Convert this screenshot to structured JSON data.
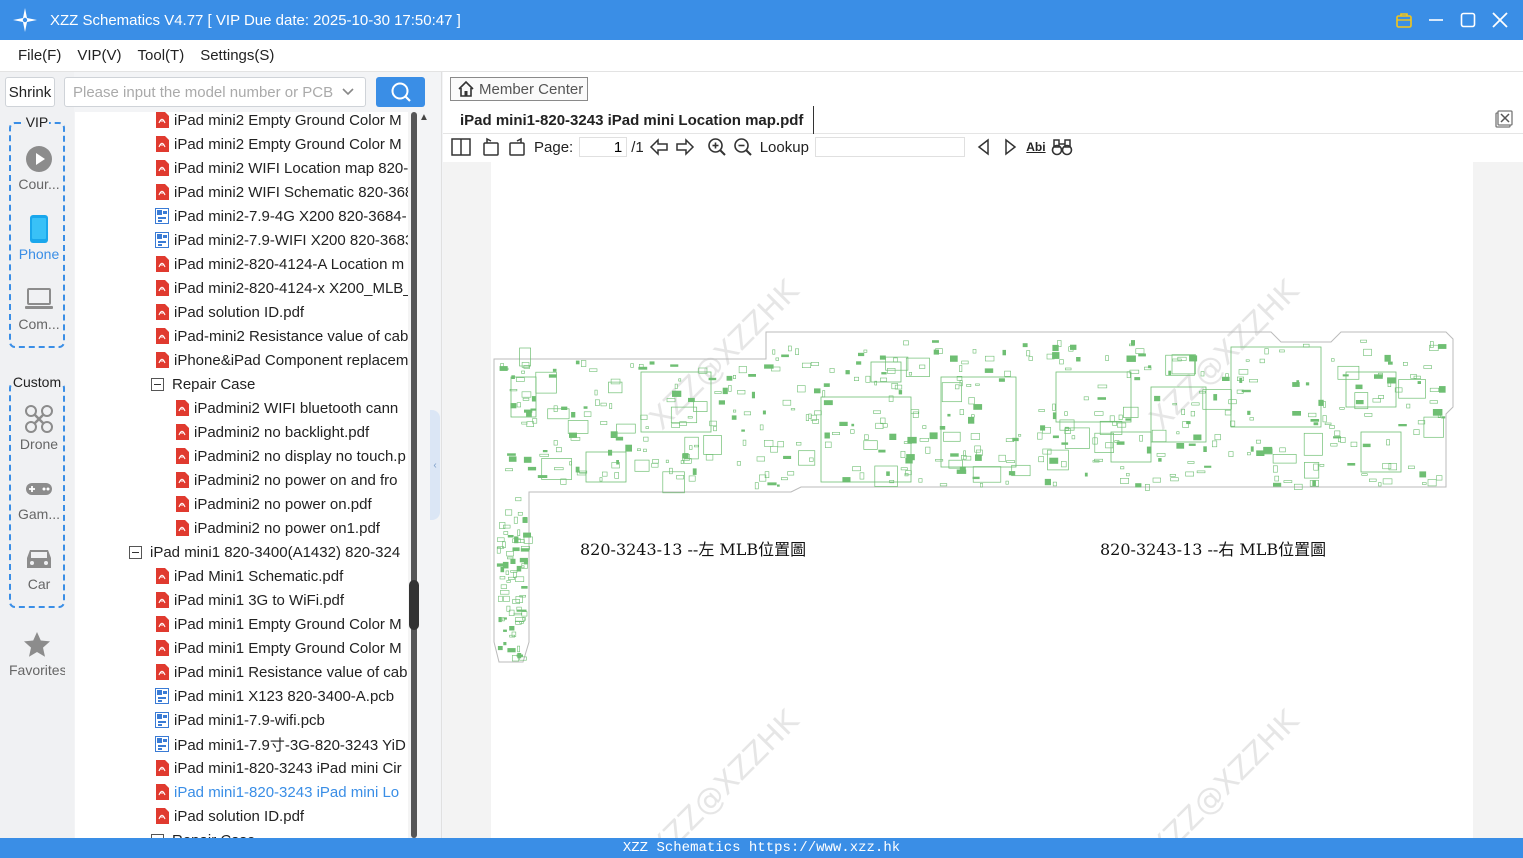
{
  "window": {
    "title": "XZZ Schematics V4.77 [ VIP Due date: 2025-10-30 17:50:47 ]",
    "controls": [
      "vip-bag-icon",
      "minimize-icon",
      "maximize-icon",
      "close-icon"
    ]
  },
  "menu": [
    {
      "label": "File(F)"
    },
    {
      "label": "VIP(V)"
    },
    {
      "label": "Tool(T)"
    },
    {
      "label": "Settings(S)"
    }
  ],
  "search": {
    "shrink_label": "Shrink",
    "placeholder": "Please input the model number or PCB",
    "value": ""
  },
  "rail": {
    "vip_group_title": "VIP",
    "custom_group_title": "Custom",
    "vip_items": [
      {
        "label": "Cour...",
        "icon": "play-circle-icon"
      },
      {
        "label": "Phone",
        "icon": "phone-icon",
        "active": true
      },
      {
        "label": "Com...",
        "icon": "laptop-icon"
      }
    ],
    "custom_items": [
      {
        "label": "Drone",
        "icon": "drone-icon"
      },
      {
        "label": "Gam...",
        "icon": "gamepad-icon"
      },
      {
        "label": "Car",
        "icon": "car-icon"
      }
    ],
    "favorites_label": "Favorites"
  },
  "tree": {
    "rows": [
      {
        "label": "iPad mini2 Empty Ground Color M",
        "type": "pdf",
        "indent": 1
      },
      {
        "label": "iPad mini2 Empty Ground Color M",
        "type": "pdf",
        "indent": 1
      },
      {
        "label": "iPad mini2 WIFI Location map 820-",
        "type": "pdf",
        "indent": 1
      },
      {
        "label": "iPad mini2 WIFI Schematic 820-368",
        "type": "pdf",
        "indent": 1
      },
      {
        "label": "iPad mini2-7.9-4G X200 820-3684-",
        "type": "pcb",
        "indent": 1
      },
      {
        "label": "iPad mini2-7.9-WIFI X200 820-3683",
        "type": "pcb",
        "indent": 1
      },
      {
        "label": "iPad mini2-820-4124-A Location m",
        "type": "pdf",
        "indent": 1
      },
      {
        "label": "iPad mini2-820-4124-x X200_MLB_",
        "type": "pdf",
        "indent": 1
      },
      {
        "label": "iPad solution ID.pdf",
        "type": "pdf",
        "indent": 1
      },
      {
        "label": "iPad-mini2 Resistance value of cab",
        "type": "pdf",
        "indent": 1
      },
      {
        "label": "iPhone&iPad Component replacem",
        "type": "pdf",
        "indent": 1
      },
      {
        "label": "Repair Case",
        "type": "folder",
        "indent": 1
      },
      {
        "label": "iPadmini2 WIFI bluetooth cann",
        "type": "pdf",
        "indent": 2
      },
      {
        "label": "iPadmini2 no backlight.pdf",
        "type": "pdf",
        "indent": 2
      },
      {
        "label": "iPadmini2 no display no touch.p",
        "type": "pdf",
        "indent": 2
      },
      {
        "label": "iPadmini2 no power on and fro",
        "type": "pdf",
        "indent": 2
      },
      {
        "label": "iPadmini2 no power on.pdf",
        "type": "pdf",
        "indent": 2
      },
      {
        "label": "iPadmini2 no power on1.pdf",
        "type": "pdf",
        "indent": 2
      },
      {
        "label": "iPad mini1 820-3400(A1432) 820-324",
        "type": "folder",
        "indent": 0
      },
      {
        "label": "iPad Mini1 Schematic.pdf",
        "type": "pdf",
        "indent": 1
      },
      {
        "label": "iPad mini1 3G to WiFi.pdf",
        "type": "pdf",
        "indent": 1
      },
      {
        "label": "iPad mini1 Empty Ground Color M",
        "type": "pdf",
        "indent": 1
      },
      {
        "label": "iPad mini1 Empty Ground Color M",
        "type": "pdf",
        "indent": 1
      },
      {
        "label": "iPad mini1 Resistance value of cab",
        "type": "pdf",
        "indent": 1
      },
      {
        "label": "iPad mini1 X123 820-3400-A.pcb",
        "type": "pcb",
        "indent": 1
      },
      {
        "label": "iPad mini1-7.9-wifi.pcb",
        "type": "pcb",
        "indent": 1
      },
      {
        "label": "iPad mini1-7.9寸-3G-820-3243 YiD",
        "type": "pcb",
        "indent": 1
      },
      {
        "label": "iPad mini1-820-3243 iPad mini Cir",
        "type": "pdf",
        "indent": 1
      },
      {
        "label": "iPad mini1-820-3243 iPad mini Lo",
        "type": "pdf",
        "indent": 1,
        "selected": true
      },
      {
        "label": "iPad solution ID.pdf",
        "type": "pdf",
        "indent": 1
      },
      {
        "label": "Repair Case",
        "type": "folder",
        "indent": 1
      }
    ]
  },
  "viewer": {
    "member_center_label": "Member Center",
    "doc_tab_title": "iPad mini1-820-3243 iPad mini Location map.pdf",
    "page_label": "Page:",
    "page_value": "1",
    "page_total": "/1",
    "lookup_label": "Lookup",
    "lookup_value": "",
    "find_text_icon_label": "Abi",
    "pdf": {
      "left_caption": "820-3243-13 --左 MLB位置圖",
      "right_caption": "820-3243-13 --右 MLB位置圖",
      "watermark": "XZZ@XZZHK"
    }
  },
  "status": {
    "text": "XZZ Schematics https://www.xzz.hk"
  },
  "colors": {
    "accent": "#3a8ee6",
    "pdf_red": "#e03a2f",
    "pcb_blue": "#3a7bd5",
    "board_green": "#6fbf73"
  }
}
